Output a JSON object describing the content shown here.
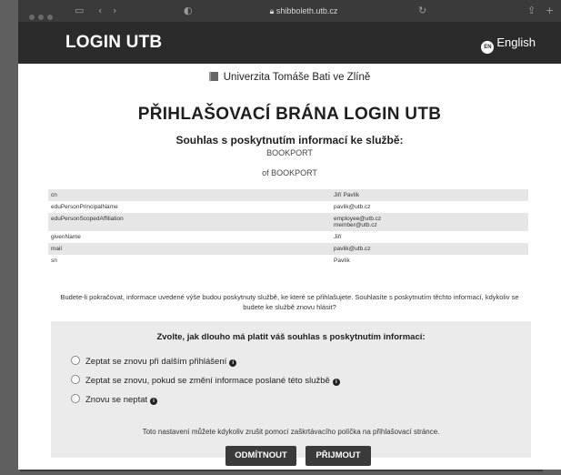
{
  "browser": {
    "url": "shibboleth.utb.cz"
  },
  "header": {
    "brand": "LOGIN UTB",
    "language_code": "EN",
    "language": "English"
  },
  "university": "Univerzita Tomáše Bati ve Zlíně",
  "page_title": "PŘIHLAŠOVACÍ BRÁNA LOGIN UTB",
  "consent_heading": "Souhlas s poskytnutím informací ke službě:",
  "service_name": "BOOKPORT",
  "service_of": "of BOOKPORT",
  "attributes": [
    {
      "name": "cn",
      "value": "Jiří Pavlík"
    },
    {
      "name": "eduPersonPrincipalName",
      "value": "pavlik@utb.cz"
    },
    {
      "name": "eduPersonScopedAffiliation",
      "value": "employee@utb.cz",
      "value2": "member@utb.cz"
    },
    {
      "name": "givenName",
      "value": "Jiří"
    },
    {
      "name": "mail",
      "value": "pavlik@utb.cz"
    },
    {
      "name": "sn",
      "value": "Pavlík"
    }
  ],
  "notice": "Budete-li pokračovat, informace uvedené výše budou poskytnuty službě, ke které se přihlašujete. Souhlasíte s poskytnutím těchto informací, kdykoliv se budete ke službě znovu hlásit?",
  "duration": {
    "question": "Zvolte, jak dlouho má platit váš souhlas s poskytnutím informací:",
    "options": [
      "Zeptat se znovu při dalším přihlášení",
      "Zeptat se znovu, pokud se změní informace poslané této službě",
      "Znovu se neptat"
    ],
    "hint": "Toto nastavení můžete kdykoliv zrušit pomocí zaškrtávacího políčka na přihlašovací stránce."
  },
  "buttons": {
    "reject": "ODMÍTNOUT",
    "accept": "PŘIJMOUT"
  }
}
